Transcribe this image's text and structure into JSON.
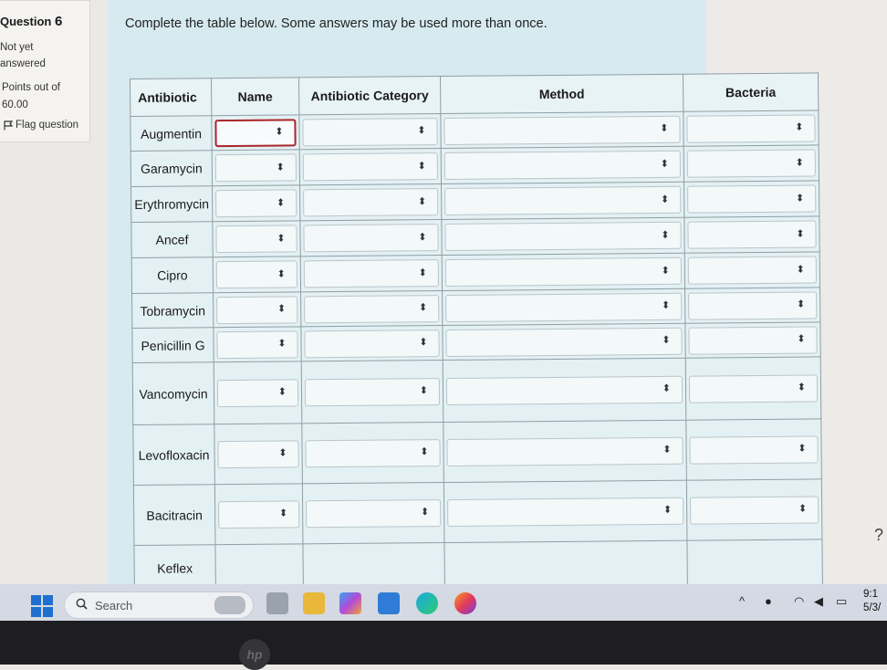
{
  "sidebar": {
    "question_word": "Question",
    "question_number": "6",
    "status_line1": "Not yet",
    "status_line2": "answered",
    "points_label": "Points out of",
    "points_value": "60.00",
    "flag_label": "Flag question"
  },
  "question": {
    "instruction": "Complete the table below. Some answers may be used more than once."
  },
  "table": {
    "headers": [
      "Antibiotic",
      "Name",
      "Antibiotic Category",
      "Method",
      "Bacteria"
    ],
    "rows": [
      {
        "antibiotic": "Augmentin"
      },
      {
        "antibiotic": "Garamycin"
      },
      {
        "antibiotic": "Erythromycin"
      },
      {
        "antibiotic": "Ancef"
      },
      {
        "antibiotic": "Cipro"
      },
      {
        "antibiotic": "Tobramycin"
      },
      {
        "antibiotic": "Penicillin G"
      },
      {
        "antibiotic": "Vancomycin"
      },
      {
        "antibiotic": "Levofloxacin"
      },
      {
        "antibiotic": "Bacitracin"
      },
      {
        "antibiotic": "Keflex"
      }
    ],
    "select_indicator": "⬍"
  },
  "help": "?",
  "taskbar": {
    "search_label": "Search",
    "clock_time": "9:1",
    "clock_date": "5/3/",
    "icons": [
      "windows-start-icon",
      "search-icon",
      "task-view-icon",
      "file-explorer-icon",
      "copilot-icon",
      "store-icon",
      "edge-icon",
      "firefox-icon"
    ]
  },
  "colors": {
    "question_panel": "#d6eaf0",
    "focus_border": "#a8262b",
    "windows_blue": "#1f6fd0"
  }
}
